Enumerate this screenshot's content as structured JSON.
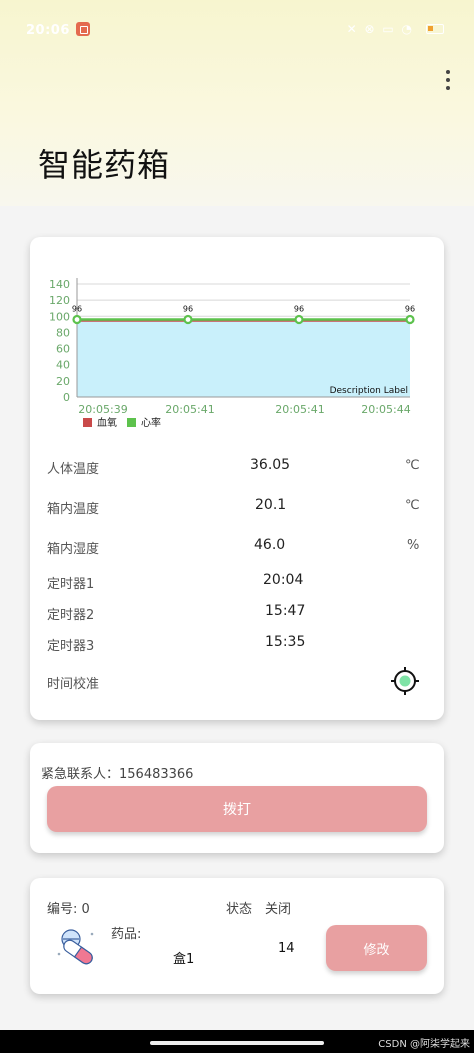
{
  "status_bar": {
    "time": "20:06",
    "right_icons": "✕ ⊗ ▭ ◔"
  },
  "app": {
    "title": "智能药箱",
    "menu_icon": "more-vertical-icon"
  },
  "chart_data": {
    "type": "area",
    "x": [
      "20:05:39",
      "20:05:41",
      "20:05:41",
      "20:05:44"
    ],
    "xticks": [
      "20:05:39",
      "20:05:41",
      "20:05:41",
      "20:05:44"
    ],
    "series": [
      {
        "name": "血氧",
        "values": [
          96,
          96,
          96,
          96
        ],
        "color": "#c94a4a"
      },
      {
        "name": "心率",
        "values": [
          96,
          96,
          96,
          96
        ],
        "color": "#5dc24d"
      }
    ],
    "data_labels": [
      "96",
      "96",
      "96",
      "96"
    ],
    "ylim": [
      0,
      140
    ],
    "yticks": [
      "0",
      "20",
      "40",
      "60",
      "80",
      "100",
      "120",
      "140"
    ],
    "description": "Description Label",
    "fill_color": "#c9f0fb",
    "legend_position": "bottom-left"
  },
  "readings": {
    "body_temp": {
      "label": "人体温度",
      "value": "36.05",
      "unit": "℃"
    },
    "box_temp": {
      "label": "箱内温度",
      "value": "20.1",
      "unit": "℃"
    },
    "box_humidity": {
      "label": "箱内湿度",
      "value": "46.0",
      "unit": "%"
    },
    "timer1": {
      "label": "定时器1",
      "value": "20:04"
    },
    "timer2": {
      "label": "定时器2",
      "value": "15:47"
    },
    "timer3": {
      "label": "定时器3",
      "value": "15:35"
    },
    "calibrate": {
      "label": "时间校准",
      "icon": "crosshair-target-icon"
    }
  },
  "contact": {
    "label": "紧急联系人：156483366",
    "call_button": "拨打"
  },
  "medicine": {
    "number_label": "编号: 0",
    "status_label": "状态",
    "status_value": "关闭",
    "drug_label": "药品:",
    "drug_name": "盒1",
    "quantity": "14",
    "edit_button": "修改",
    "icon": "pill-icon"
  },
  "footer": {
    "watermark": "CSDN @阿柒学起来"
  }
}
